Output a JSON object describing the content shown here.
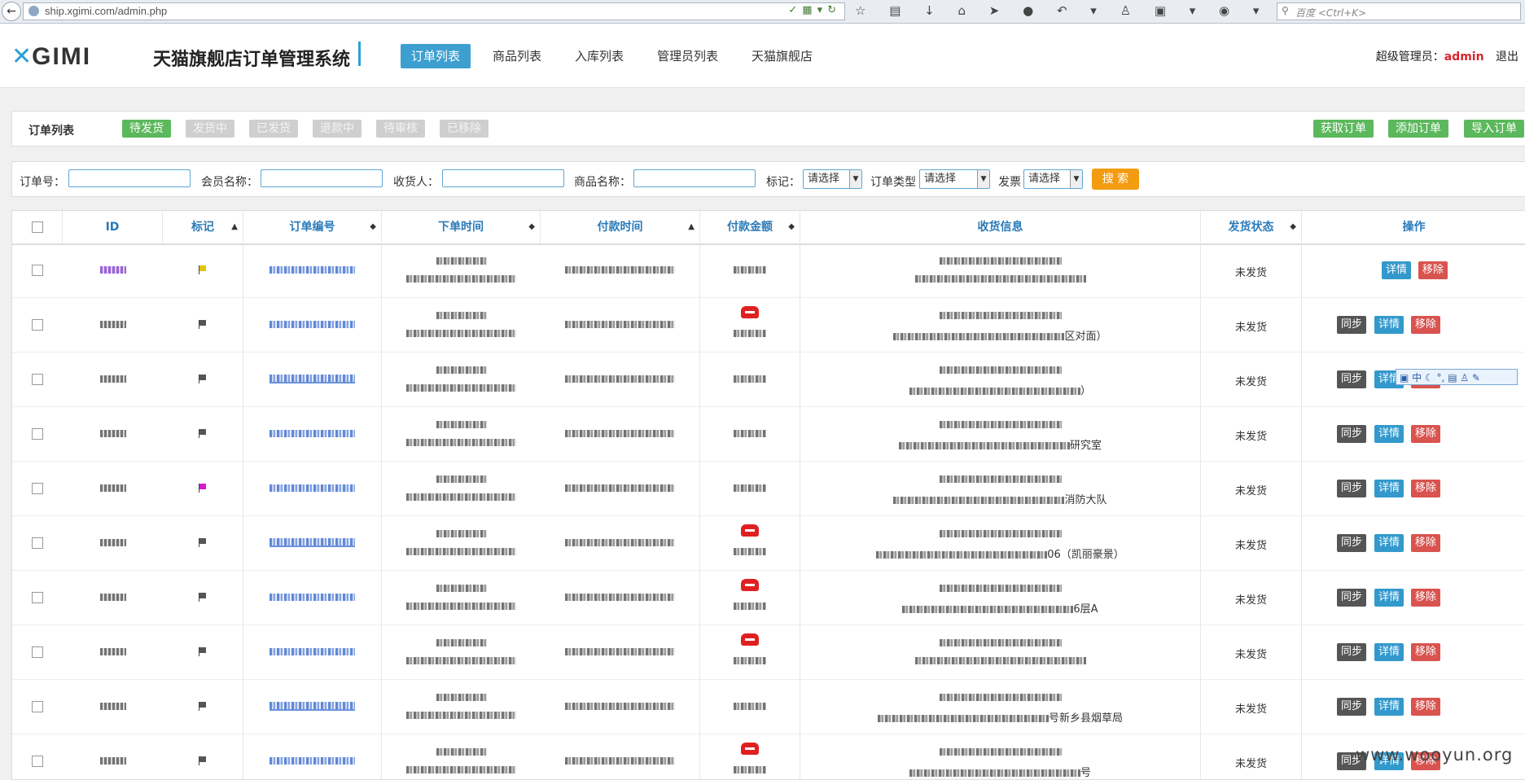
{
  "browser": {
    "url": "ship.xgimi.com/admin.php",
    "search_placeholder": "百度 <Ctrl+K>"
  },
  "header": {
    "logo_x": "✕",
    "logo_text": "GIMI",
    "system_title": "天猫旗舰店订单管理系统",
    "nav": [
      "订单列表",
      "商品列表",
      "入库列表",
      "管理员列表",
      "天猫旗舰店"
    ],
    "active_nav": "订单列表",
    "user_label": "超级管理员：",
    "user_name": "admin",
    "logout": "退出"
  },
  "status_panel": {
    "title": "订单列表",
    "status_buttons": [
      "待发货",
      "发货中",
      "已发货",
      "退款中",
      "待审核",
      "已移除"
    ],
    "active_status": "待发货",
    "action_buttons": [
      "获取订单",
      "添加订单",
      "导入订单"
    ]
  },
  "filters": {
    "order_no_label": "订单号：",
    "member_label": "会员名称：",
    "receiver_label": "收货人：",
    "product_label": "商品名称：",
    "mark_label": "标记：",
    "mark_value": "请选择",
    "type_label": "订单类型",
    "type_value": "请选择",
    "invoice_label": "发票",
    "invoice_value": "请选择",
    "search_button": "搜 索"
  },
  "table": {
    "columns": [
      "ID",
      "标记",
      "订单编号",
      "下单时间",
      "付款时间",
      "付款金额",
      "收货信息",
      "发货状态",
      "操作"
    ],
    "sorted_column": "付款时间",
    "rows": [
      {
        "status": "未发货",
        "addr_suffix": "",
        "has_sync": false,
        "amount_icon": false
      },
      {
        "status": "未发货",
        "addr_suffix": "区对面）",
        "has_sync": true,
        "amount_icon": true
      },
      {
        "status": "未发货",
        "addr_suffix": "）",
        "has_sync": true,
        "amount_icon": false
      },
      {
        "status": "未发货",
        "addr_suffix": "研究室",
        "has_sync": true,
        "amount_icon": false
      },
      {
        "status": "未发货",
        "addr_suffix": "消防大队",
        "has_sync": true,
        "amount_icon": false
      },
      {
        "status": "未发货",
        "addr_suffix": "06（凯丽豪景）",
        "has_sync": true,
        "amount_icon": true
      },
      {
        "status": "未发货",
        "addr_suffix": "6层A",
        "has_sync": true,
        "amount_icon": true
      },
      {
        "status": "未发货",
        "addr_suffix": "",
        "has_sync": true,
        "amount_icon": true
      },
      {
        "status": "未发货",
        "addr_suffix": "号新乡县烟草局",
        "has_sync": true,
        "amount_icon": false
      },
      {
        "status": "未发货",
        "addr_suffix": "号",
        "has_sync": true,
        "amount_icon": true
      }
    ],
    "ops": {
      "sync": "同步",
      "detail": "详情",
      "remove": "移除"
    }
  },
  "ime_bar": "中",
  "watermark": "www.wooyun.org"
}
